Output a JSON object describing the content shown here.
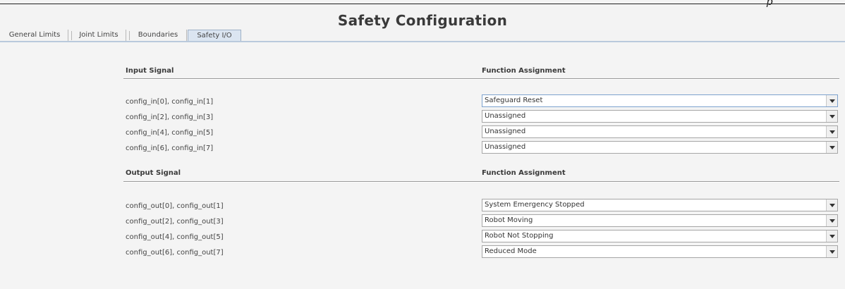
{
  "header": {
    "top_mark": "p",
    "title": "Safety Configuration"
  },
  "tabs": [
    {
      "label": "General Limits",
      "active": false
    },
    {
      "label": "Joint Limits",
      "active": false
    },
    {
      "label": "Boundaries",
      "active": false
    },
    {
      "label": "Safety I/O",
      "active": true
    }
  ],
  "inputs": {
    "heading_signal": "Input Signal",
    "heading_function": "Function Assignment",
    "rows": [
      {
        "signal": "config_in[0], config_in[1]",
        "function": "Safeguard Reset"
      },
      {
        "signal": "config_in[2], config_in[3]",
        "function": "Unassigned"
      },
      {
        "signal": "config_in[4], config_in[5]",
        "function": "Unassigned"
      },
      {
        "signal": "config_in[6], config_in[7]",
        "function": "Unassigned"
      }
    ]
  },
  "outputs": {
    "heading_signal": "Output Signal",
    "heading_function": "Function Assignment",
    "rows": [
      {
        "signal": "config_out[0], config_out[1]",
        "function": "System Emergency Stopped"
      },
      {
        "signal": "config_out[2], config_out[3]",
        "function": "Robot Moving"
      },
      {
        "signal": "config_out[4], config_out[5]",
        "function": "Robot Not Stopping"
      },
      {
        "signal": "config_out[6], config_out[7]",
        "function": "Reduced Mode"
      }
    ]
  },
  "icons": {
    "dropdown_arrow": "chevron-down-icon"
  },
  "colors": {
    "active_tab": "#dbe5f1",
    "tab_underline": "#b9c9dc",
    "focused_border": "#7da2ce"
  }
}
